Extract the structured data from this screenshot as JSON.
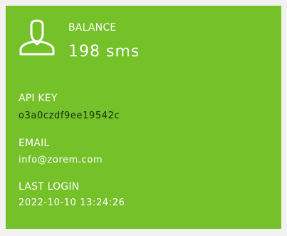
{
  "account": {
    "balance_label": "BALANCE",
    "balance_value": "198 sms",
    "api_key_label": "API KEY",
    "api_key_value": "o3a0czdf9ee19542c",
    "email_label": "EMAIL",
    "email_value": "info@zorem.com",
    "last_login_label": "LAST LOGIN",
    "last_login_value": "2022-10-10 13:24:26"
  },
  "icons": {
    "user": "user-icon"
  },
  "colors": {
    "card_background": "#74c12a",
    "text": "#ffffff",
    "api_key_text": "#1b2a10",
    "page_background": "#f2f2f2"
  }
}
